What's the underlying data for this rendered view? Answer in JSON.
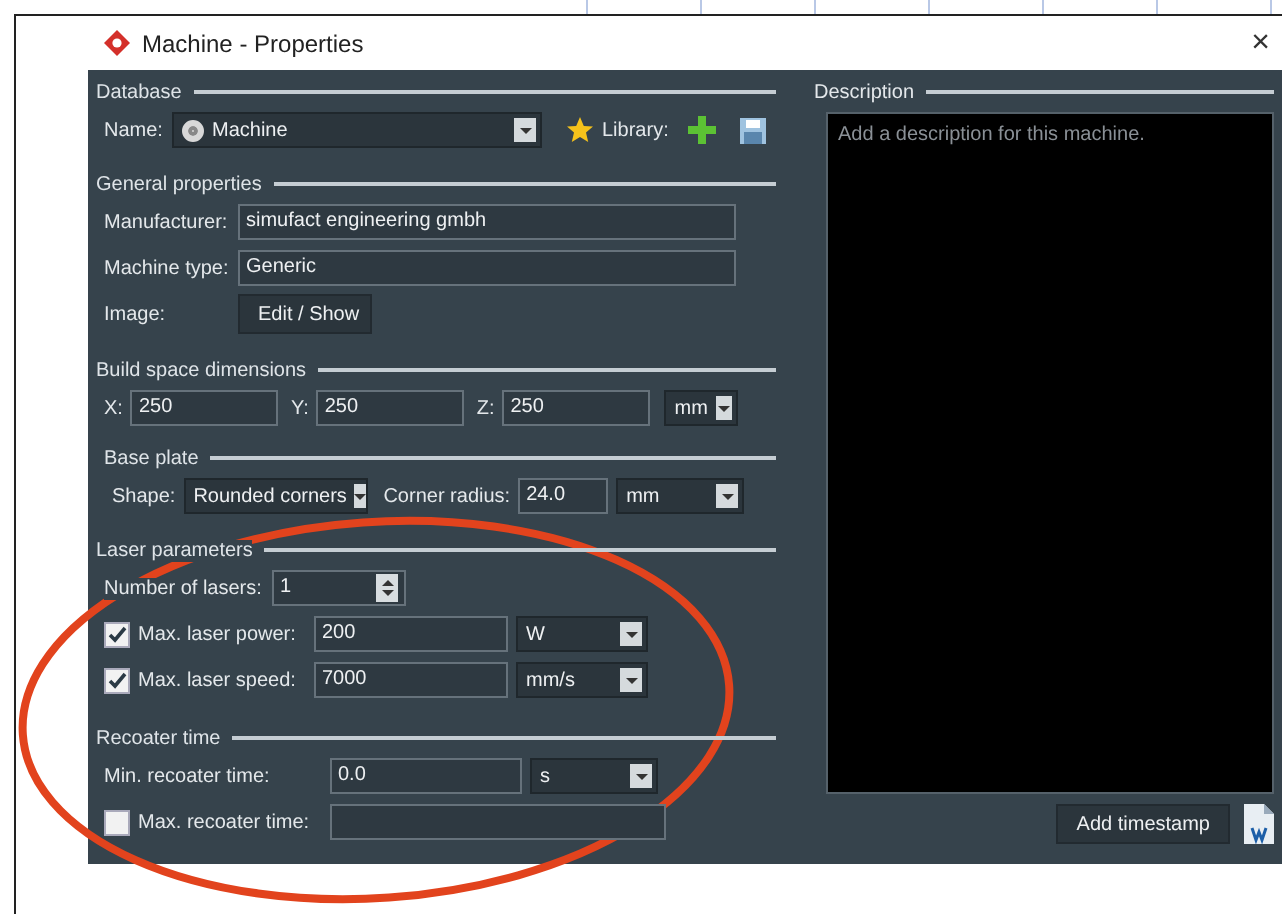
{
  "window": {
    "title": "Machine - Properties",
    "close": "×"
  },
  "database": {
    "heading": "Database",
    "name_label": "Name:",
    "name_value": "Machine",
    "library_label": "Library:"
  },
  "general": {
    "heading": "General properties",
    "fields": [
      {
        "label": "Manufacturer:",
        "value": "simufact engineering gmbh"
      },
      {
        "label": "Machine type:",
        "value": "Generic"
      }
    ],
    "image_label": "Image:",
    "image_button": "Edit / Show"
  },
  "build_space": {
    "heading": "Build space dimensions",
    "dims": [
      {
        "label": "X:",
        "value": "250"
      },
      {
        "label": "Y:",
        "value": "250"
      },
      {
        "label": "Z:",
        "value": "250"
      }
    ],
    "unit": "mm"
  },
  "base_plate": {
    "heading": "Base plate",
    "shape_label": "Shape:",
    "shape": "Rounded corners",
    "radius_label": "Corner radius:",
    "radius": "24.0",
    "unit": "mm"
  },
  "laser": {
    "heading": "Laser parameters",
    "count_label": "Number of lasers:",
    "count": "1",
    "limits": [
      {
        "label": "Max. laser power:",
        "checked": true,
        "value": "200",
        "unit": "W"
      },
      {
        "label": "Max. laser speed:",
        "checked": true,
        "value": "7000",
        "unit": "mm/s"
      }
    ]
  },
  "recoater": {
    "heading": "Recoater time",
    "rows": [
      {
        "kind": "plain",
        "label": "Min. recoater time:",
        "value": "0.0",
        "unit": "s"
      },
      {
        "kind": "checkbox",
        "label": "Max. recoater time:",
        "checked": false
      }
    ]
  },
  "description": {
    "heading": "Description",
    "placeholder": "Add a description for this machine.",
    "button": "Add timestamp"
  }
}
